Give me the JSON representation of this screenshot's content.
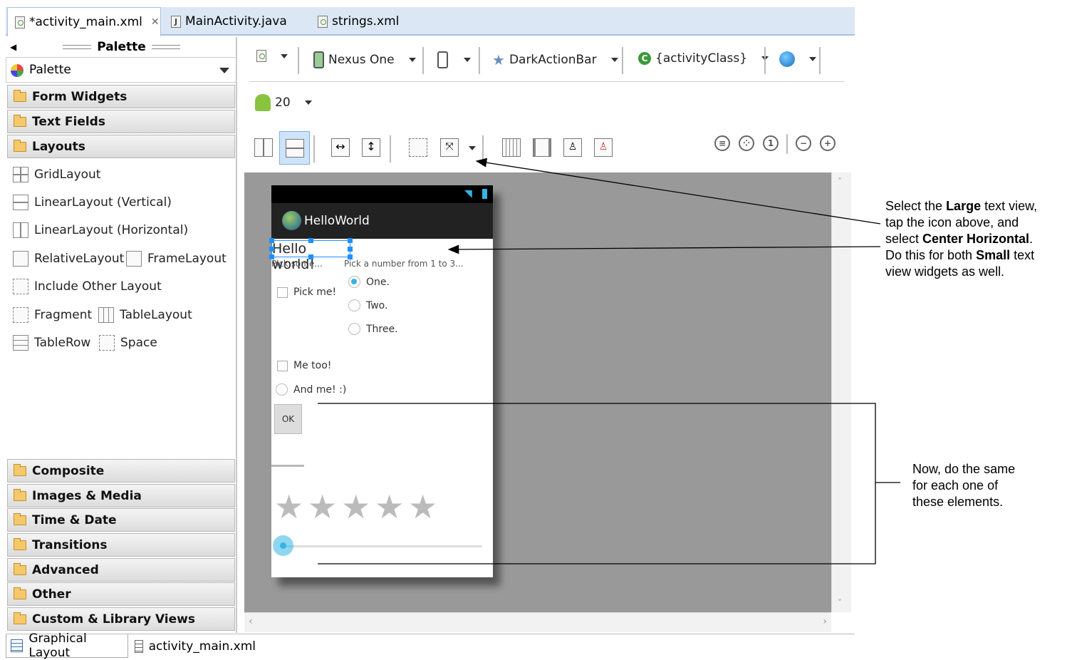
{
  "editor_tabs": [
    {
      "label": "*activity_main.xml",
      "active": true
    },
    {
      "label": "MainActivity.java",
      "active": false
    },
    {
      "label": "strings.xml",
      "active": false
    }
  ],
  "palette": {
    "header": "Palette",
    "dropdown": "Palette",
    "categories_top": [
      "Form Widgets",
      "Text Fields",
      "Layouts"
    ],
    "layout_items": [
      "GridLayout",
      "LinearLayout (Vertical)",
      "LinearLayout (Horizontal)",
      "RelativeLayout",
      "FrameLayout",
      "Include Other Layout",
      "Fragment",
      "TableLayout",
      "TableRow",
      "Space"
    ],
    "categories_bottom": [
      "Composite",
      "Images & Media",
      "Time & Date",
      "Transitions",
      "Advanced",
      "Other",
      "Custom & Library Views"
    ]
  },
  "toolbar": {
    "device": "Nexus One",
    "theme": "DarkActionBar",
    "activity": "{activityClass}",
    "api_level": "20"
  },
  "preview": {
    "app_title": "HelloWorld",
    "hello": "Hello world!",
    "small_left": "Pick some...",
    "small_right": "Pick a number from 1 to 3...",
    "checkbox1": "Pick me!",
    "radio_one": "One.",
    "radio_two": "Two.",
    "radio_three": "Three.",
    "checkbox2": "Me too!",
    "radio_andme": "And me! :)",
    "button_ok": "OK",
    "rating_stars": 5
  },
  "annotations": {
    "note1_lines": [
      "Select the ",
      "Large",
      " text view,",
      "tap the icon above, and",
      "select ",
      "Center Horizontal",
      ".",
      "Do this for both ",
      "Small",
      " text",
      "view widgets as well."
    ],
    "note2_lines": [
      "Now, do the same",
      "for each one of",
      "these elements."
    ]
  },
  "bottom_tabs": [
    {
      "label": "Graphical Layout",
      "active": true
    },
    {
      "label": "activity_main.xml",
      "active": false
    }
  ]
}
